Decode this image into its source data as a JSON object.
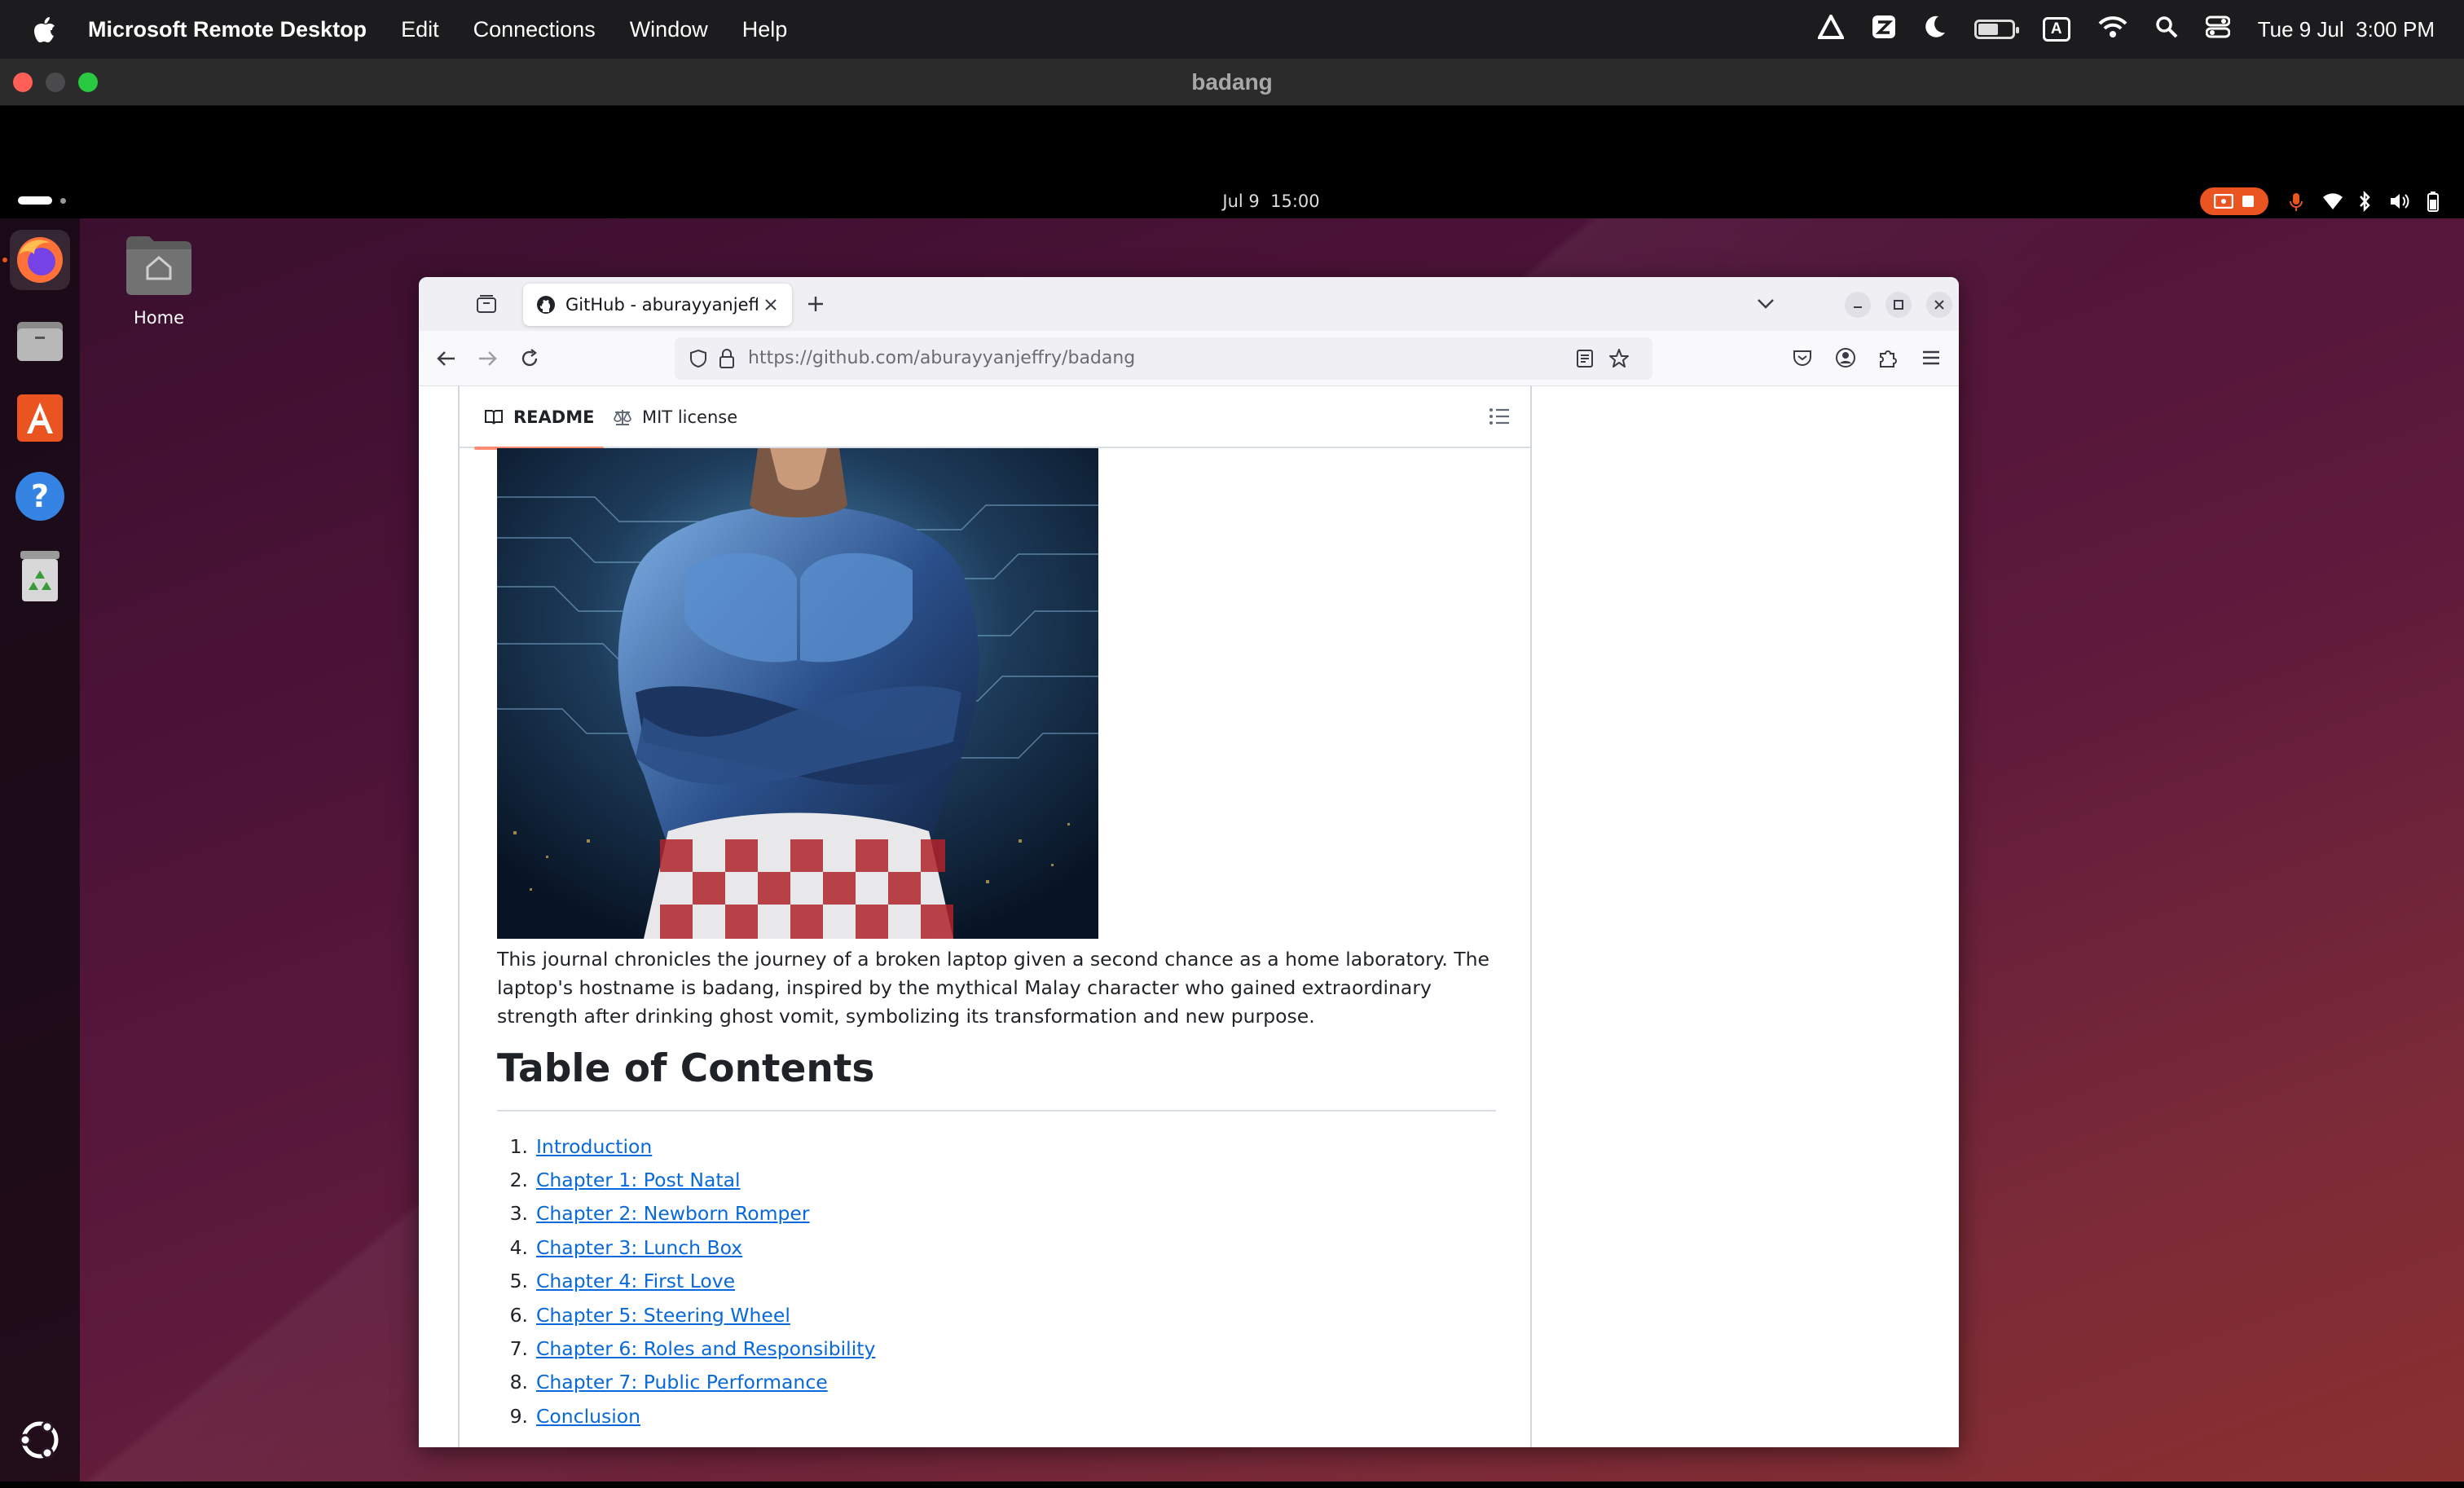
{
  "mac_menubar": {
    "app_name": "Microsoft Remote Desktop",
    "menus": [
      "Edit",
      "Connections",
      "Window",
      "Help"
    ],
    "input_badge": "A",
    "clock": "Tue 9 Jul  3:00 PM",
    "battery_level": 0.55
  },
  "rdp_window": {
    "title": "badang"
  },
  "ubuntu": {
    "clock": "Jul 9  15:00",
    "desktop_icon_label": "Home"
  },
  "browser": {
    "tab_title": "GitHub - aburayyanjeffry/",
    "url_host": "https://github.com/",
    "url_path": "aburayyanjeffry/badang"
  },
  "readme": {
    "tabs": {
      "readme": "README",
      "license": "MIT license"
    },
    "description": "This journal chronicles the journey of a broken laptop given a second chance as a home laboratory. The laptop's hostname is badang, inspired by the mythical Malay character who gained extraordinary strength after drinking ghost vomit, symbolizing its transformation and new purpose.",
    "toc_title": "Table of Contents",
    "toc": [
      {
        "num": "1.",
        "label": "Introduction"
      },
      {
        "num": "2.",
        "label": "Chapter 1: Post Natal"
      },
      {
        "num": "3.",
        "label": "Chapter 2: Newborn Romper"
      },
      {
        "num": "4.",
        "label": "Chapter 3: Lunch Box"
      },
      {
        "num": "5.",
        "label": "Chapter 4: First Love"
      },
      {
        "num": "6.",
        "label": "Chapter 5: Steering Wheel"
      },
      {
        "num": "7.",
        "label": "Chapter 6: Roles and Responsibility"
      },
      {
        "num": "8.",
        "label": "Chapter 7: Public Performance"
      },
      {
        "num": "9.",
        "label": "Conclusion"
      }
    ]
  }
}
